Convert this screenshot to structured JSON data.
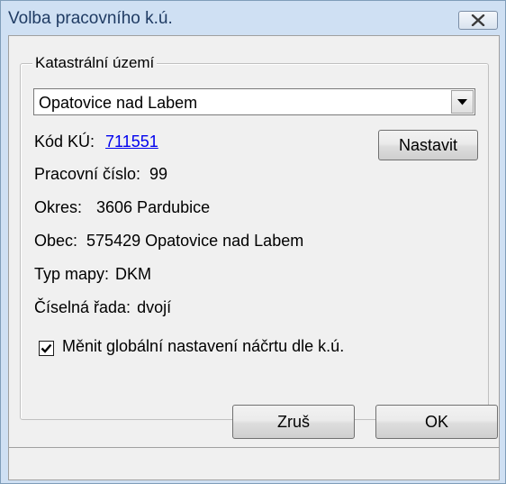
{
  "window": {
    "title": "Volba pracovního k.ú."
  },
  "group": {
    "legend": "Katastrální území"
  },
  "combo": {
    "selected": "Opatovice nad Labem"
  },
  "info": {
    "kod_label": "Kód KÚ:",
    "kod_value": "711551",
    "pracovni_label": "Pracovní číslo:",
    "pracovni_value": "99",
    "okres_label": "Okres:",
    "okres_value": "3606 Pardubice",
    "obec_label": "Obec:",
    "obec_value": "575429 Opatovice nad Labem",
    "typ_label": "Typ mapy:",
    "typ_value": "DKM",
    "rada_label": "Číselná řada:",
    "rada_value": "dvojí"
  },
  "buttons": {
    "nastavit": "Nastavit",
    "zrus": "Zruš",
    "ok": "OK"
  },
  "checkbox": {
    "label": "Měnit globální nastavení náčrtu dle k.ú.",
    "checked": true
  },
  "icons": {
    "close": "close-icon",
    "dropdown": "chevron-down-icon",
    "check": "checkmark-icon"
  }
}
